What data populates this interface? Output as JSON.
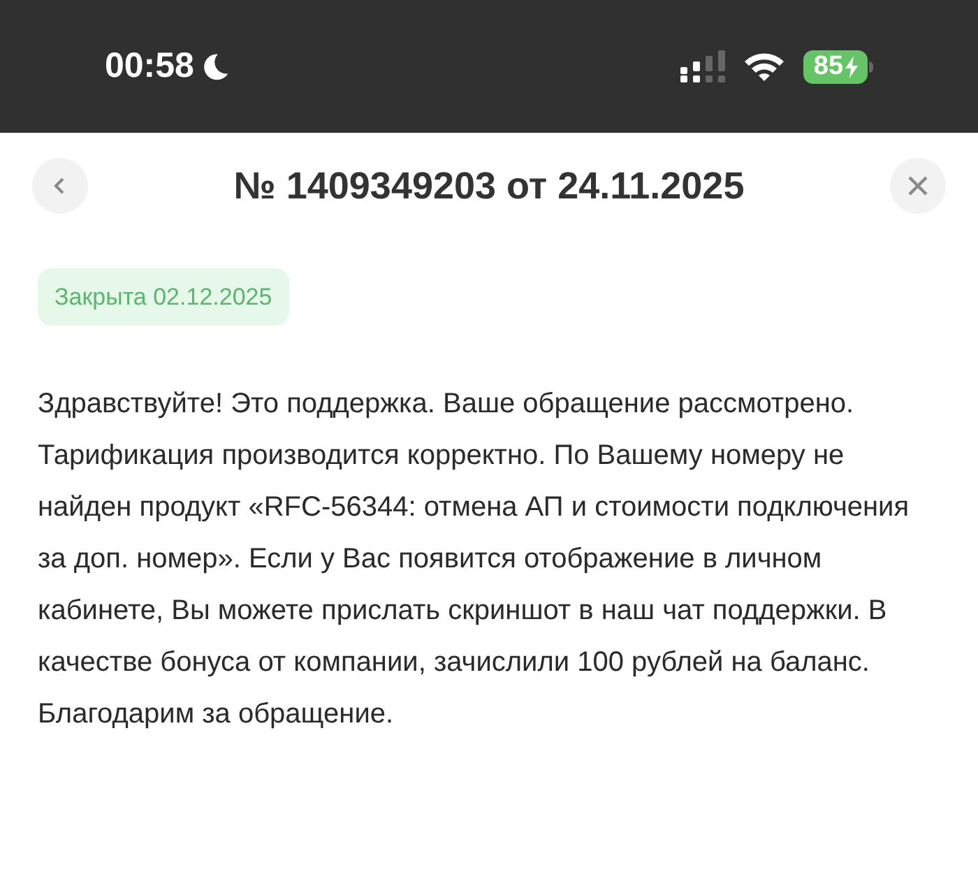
{
  "status_bar": {
    "time": "00:58",
    "battery": "85"
  },
  "header": {
    "title": "№ 1409349203 от 24.11.2025"
  },
  "status_badge": {
    "label": "Закрыта 02.12.2025"
  },
  "message": {
    "text": "Здравствуйте! Это поддержка. Ваше обращение рассмотрено. Тарификация производится корректно. По Вашему номеру не найден продукт «RFC-56344: отмена АП и стоимости подключения за доп. номер». Если у Вас появится отображение в личном кабинете, Вы можете прислать скриншот в наш чат поддержки. В качестве бонуса от компании, зачислили 100 рублей на баланс. Благодарим за обращение."
  }
}
